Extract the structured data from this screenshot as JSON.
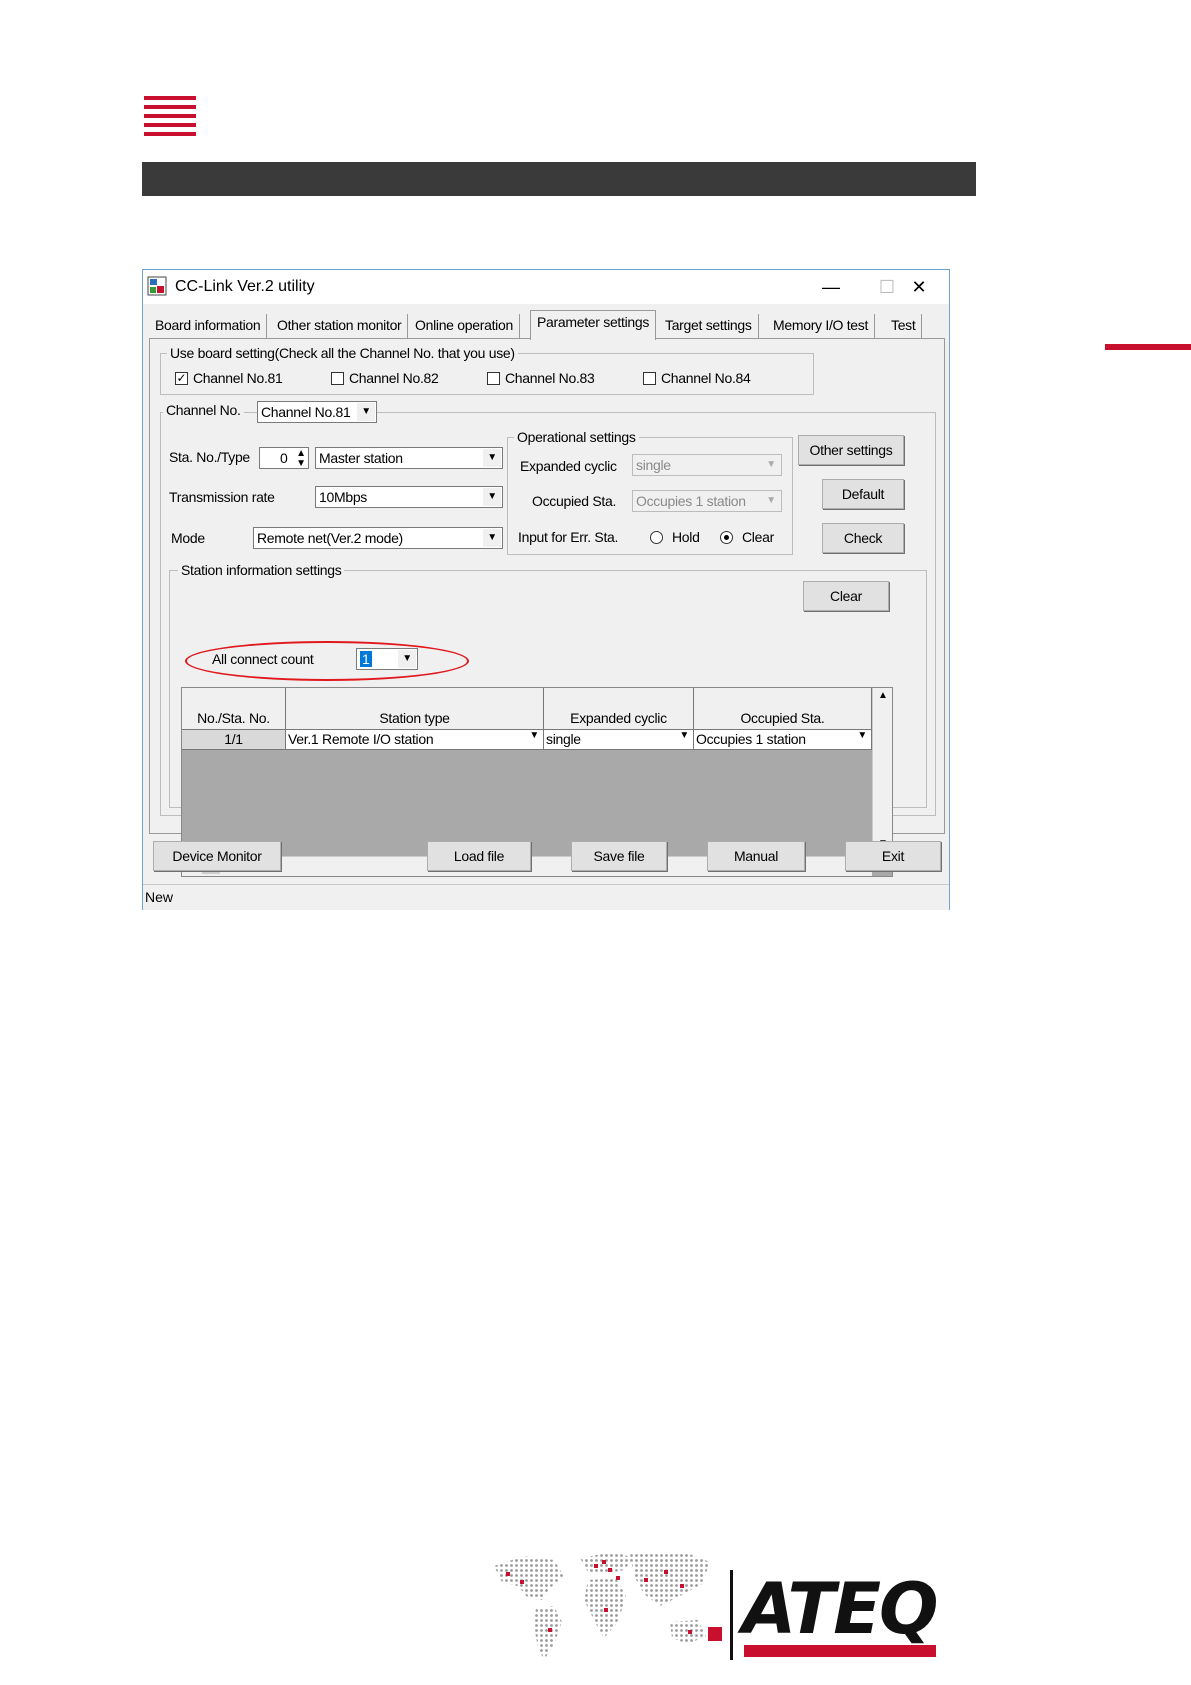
{
  "window": {
    "title": "CC-Link Ver.2 utility",
    "minimize": "—",
    "maximize": "☐",
    "close": "✕"
  },
  "tabs": [
    {
      "label": "Board information"
    },
    {
      "label": "Other station monitor"
    },
    {
      "label": "Online operation"
    },
    {
      "label": "Parameter settings"
    },
    {
      "label": "Target settings"
    },
    {
      "label": "Memory I/O test"
    },
    {
      "label": "Test"
    }
  ],
  "board_setting": {
    "legend": "Use board setting(Check all the Channel No. that you use)",
    "channels": [
      {
        "label": "Channel No.81",
        "checked": true
      },
      {
        "label": "Channel No.82",
        "checked": false
      },
      {
        "label": "Channel No.83",
        "checked": false
      },
      {
        "label": "Channel No.84",
        "checked": false
      }
    ],
    "check_mark": "✓"
  },
  "channel": {
    "label": "Channel No.",
    "value": "Channel No.81"
  },
  "sta": {
    "label": "Sta. No./Type",
    "number": "0",
    "type": "Master station"
  },
  "transmission": {
    "label": "Transmission rate",
    "value": "10Mbps"
  },
  "mode": {
    "label": "Mode",
    "value": "Remote net(Ver.2 mode)"
  },
  "operational": {
    "legend": "Operational settings",
    "expanded_label": "Expanded cyclic",
    "expanded_value": "single",
    "occupied_label": "Occupied Sta.",
    "occupied_value": "Occupies 1 station",
    "input_label": "Input for Err. Sta.",
    "hold": "Hold",
    "clear": "Clear"
  },
  "buttons": {
    "other_settings": "Other settings",
    "default": "Default",
    "check": "Check",
    "clear": "Clear"
  },
  "station_info": {
    "legend": "Station information settings",
    "all_connect_label": "All connect count",
    "all_connect_value": "1",
    "columns": [
      "No./Sta. No.",
      "Station type",
      "Expanded cyclic",
      "Occupied Sta."
    ],
    "rows": [
      [
        "1/1",
        "Ver.1 Remote I/O station",
        "single",
        "Occupies 1 station"
      ]
    ]
  },
  "bottom_buttons": {
    "device_monitor": "Device Monitor",
    "load_file": "Load file",
    "save_file": "Save file",
    "manual": "Manual",
    "exit": "Exit"
  },
  "status_bar": "New",
  "footer": {
    "logo": "ATEQ"
  },
  "colors": {
    "accent": "#c8102e",
    "highlight": "#e0191e",
    "selection": "#0078d7"
  }
}
